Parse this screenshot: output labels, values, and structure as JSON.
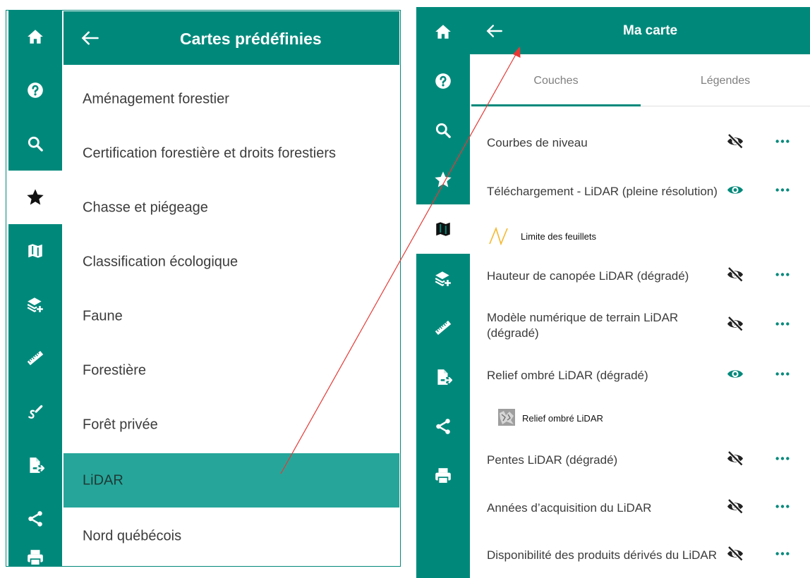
{
  "panel_a": {
    "header": {
      "title": "Cartes prédéfinies"
    },
    "items": [
      {
        "label": "Aménagement forestier",
        "selected": false
      },
      {
        "label": "Certification forestière et droits forestiers",
        "selected": false
      },
      {
        "label": "Chasse et piégeage",
        "selected": false
      },
      {
        "label": "Classification écologique",
        "selected": false
      },
      {
        "label": "Faune",
        "selected": false
      },
      {
        "label": "Forestière",
        "selected": false
      },
      {
        "label": "Forêt privée",
        "selected": false
      },
      {
        "label": "LiDAR",
        "selected": true
      },
      {
        "label": "Nord québécois",
        "selected": false
      }
    ],
    "rail_icons": [
      "home-icon",
      "help-icon",
      "search-icon",
      "star-icon",
      "map-icon",
      "add-layer-icon",
      "ruler-icon",
      "draw-icon",
      "export-icon",
      "share-icon",
      "print-icon"
    ],
    "active_rail_icon": "star-icon"
  },
  "panel_b": {
    "header": {
      "title": "Ma carte"
    },
    "tabs": [
      {
        "label": "Couches",
        "active": true
      },
      {
        "label": "Légendes",
        "active": false
      }
    ],
    "layers": [
      {
        "name": "Courbes de niveau",
        "visible": false
      },
      {
        "name": "Téléchargement - LiDAR (pleine résolution)",
        "visible": true
      },
      {
        "name": "Hauteur de canopée LiDAR (dégradé)",
        "visible": false
      },
      {
        "name": "Modèle numérique de terrain LiDAR (dégradé)",
        "visible": false
      },
      {
        "name": "Relief ombré LiDAR (dégradé)",
        "visible": true
      },
      {
        "name": "Pentes LiDAR (dégradé)",
        "visible": false
      },
      {
        "name": "Années d’acquisition du LiDAR",
        "visible": false
      },
      {
        "name": "Disponibilité des produits dérivés du LiDAR",
        "visible": false
      }
    ],
    "legends": [
      {
        "label": "Limite des feuillets",
        "icon": "sheet-boundary-legend-icon"
      },
      {
        "label": "Relief ombré LiDAR",
        "icon": "hillshade-legend-icon"
      }
    ],
    "rail_icons": [
      "home-icon",
      "help-icon",
      "search-icon",
      "star-icon",
      "map-icon",
      "add-layer-icon",
      "ruler-icon",
      "export-icon",
      "share-icon",
      "print-icon"
    ],
    "active_rail_icon": "map-icon"
  },
  "colors": {
    "primary": "#00897b",
    "selected": "#26a69a",
    "arrow": "#e53935",
    "legend_line": "#f5b82e"
  }
}
